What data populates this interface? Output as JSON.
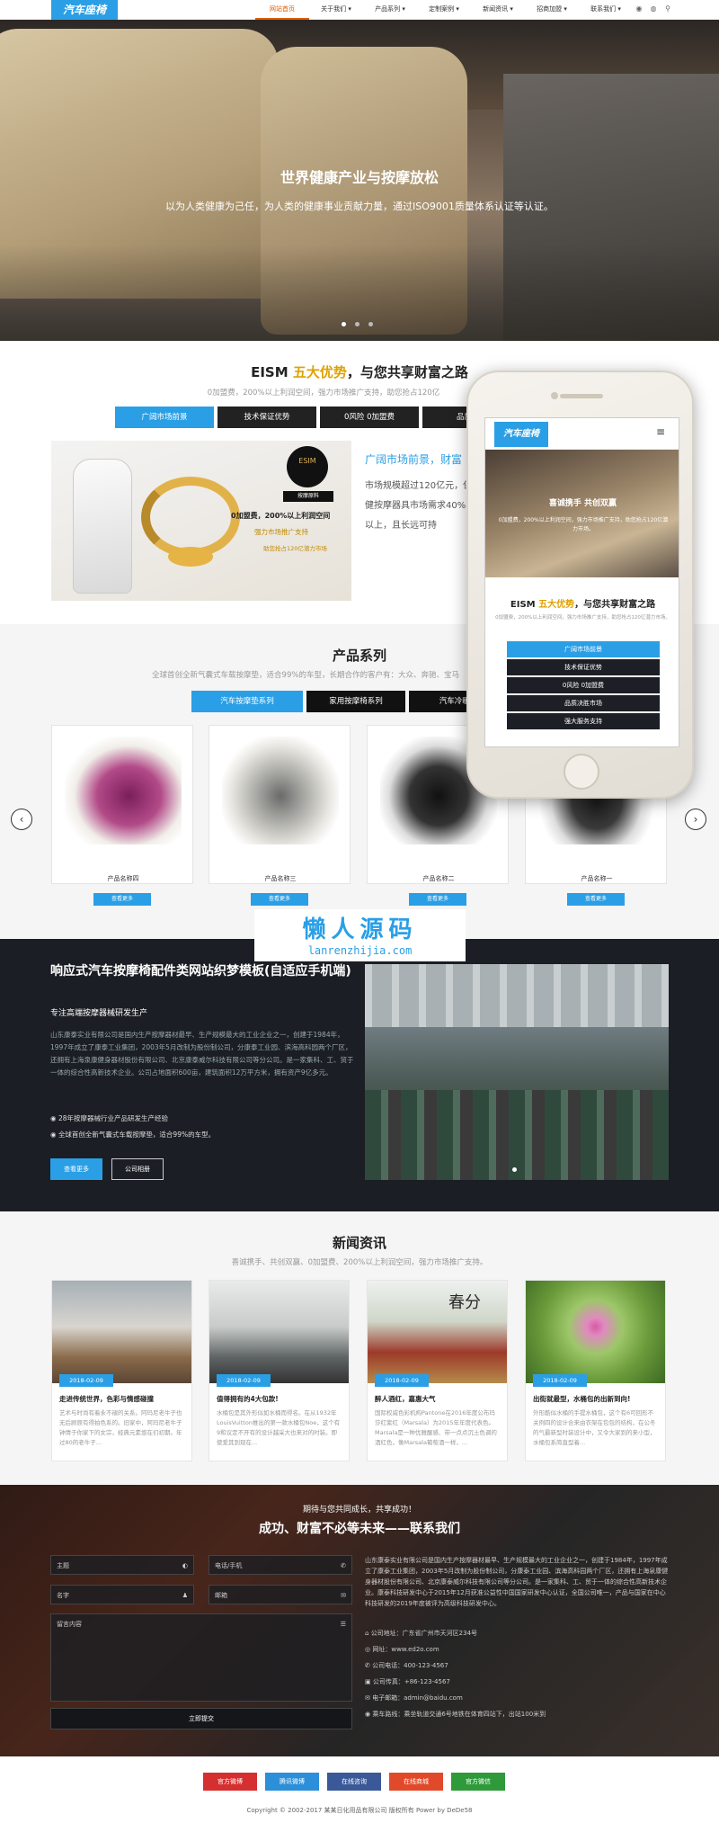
{
  "header": {
    "logo": "汽车座椅",
    "nav": [
      "网站首页",
      "关于我们 ▾",
      "产品系列 ▾",
      "定制案例 ▾",
      "新闻资讯 ▾",
      "招商加盟 ▾",
      "联系我们 ▾"
    ],
    "icons": [
      "weibo-icon",
      "wechat-icon",
      "search-icon"
    ]
  },
  "hero": {
    "title": "世界健康产业与按摩放松",
    "subtitle": "以为人类健康为己任，为人类的健康事业贡献力量，通过ISO9001质量体系认证等认证。"
  },
  "advantages": {
    "title_prefix": "EISM ",
    "title_em": "五大优势",
    "title_suffix": "，与您共享财富之路",
    "subtitle": "0加盟费，200%以上利润空间，强力市场推广支持，助您抢占120亿",
    "tabs": [
      "广阔市场前景",
      "技术保证优势",
      "0风险 0加盟费",
      "品质决胜"
    ],
    "panel_title": "广阔市场前景，财富",
    "panel_text": "市场规模超过120亿元，保健按摩器具市场需求40%以上，且长远可持",
    "img_badge": "ESIM",
    "img_badge_sub": "按摩原料",
    "img_line1": "0加盟费，200%以上利润空间",
    "img_line2": "强力市场推广支持",
    "img_line3": "助您抢占120亿潜力市场"
  },
  "products": {
    "title": "产品系列",
    "subtitle": "全球首创全新气囊式车载按摩垫，适合99%的车型，长期合作的客户有：大众、奔驰、宝马",
    "tabs": [
      "汽车按摩垫系列",
      "家用按摩椅系列",
      "汽车冷暖垫"
    ],
    "items": [
      {
        "name": "产品名称四",
        "more": "查看更多"
      },
      {
        "name": "产品名称三",
        "more": "查看更多"
      },
      {
        "name": "产品名称二",
        "more": "查看更多"
      },
      {
        "name": "产品名称一",
        "more": "查看更多"
      }
    ]
  },
  "watermark": {
    "a": "懒人源码",
    "b": "lanrenzhijia.com"
  },
  "about": {
    "title": "响应式汽车按摩椅配件类网站织梦模板(自适应手机端)",
    "sub": "专注高端按摩器械研发生产",
    "text": "山东康泰实业有限公司是国内生产按摩器材最早、生产规模最大的工业企业之一，创建于1984年，1997年成立了康泰工业集团，2003年5月改制为股份制公司，分康泰工业园、滨海高科园两个厂区，还拥有上海泉康健身器材股份有限公司、北京康泰威尔科技有限公司等分公司。是一家集科、工、贸于一体的综合性高新技术企业。公司占地面积600亩，建筑面积12万平方米，拥有资产9亿多元。",
    "points": [
      "28年按摩器械行业产品研发生产经验",
      "全球首创全新气囊式车载按摩垫，适合99%的车型。"
    ],
    "btn1": "查看更多",
    "btn2": "公司相册"
  },
  "news": {
    "title": "新闻资讯",
    "subtitle": "喜诚携手、共创双赢、0加盟费、200%以上利润空间，强力市场推广支持。",
    "items": [
      {
        "date": "2018-02-09",
        "title": "走进传统世界，色彩与情感碰撞",
        "desc": "艺术与时尚有着永不褪的关系。阿玛尼老牛子也无后顾原有得拍色系的。旧家中，阿玛尼老牛子钟情于你家下的女宗，经典元素悠在们初期。年过80的老牛子..."
      },
      {
        "date": "2018-02-09",
        "title": "值得拥有的4大包款!",
        "desc": "水桶包是其外形似如水桶而得名。在从1932年LouisVuitton推出的第一款水桶包Noe，这个有9和议定不开有的设计越采大也来对的时装。即使爱其到现在..."
      },
      {
        "date": "2018-02-09",
        "title": "醉人酒红，嘉惠大气",
        "desc": "国际权威色彩机构Pantone在2016年度公布玛莎红紫红（Marsala）为2015年年度代表色。Marsala是一种优雅醒感、带一点点沉土色调的酒红色，像Marsala葡萄酒一样，..."
      },
      {
        "date": "2018-02-09",
        "title": "出街就最型，水桶包的出新到向!",
        "desc": "外形酷似水桶的手提水桶包，这个有6可回形不关例四的设计合来由衣架在包包的结构，在公冬的气最新型时装设计中，又令大家到的来小型，水桶包系简直型着..."
      }
    ]
  },
  "contact": {
    "t1": "期待与您共同成长，共享成功！",
    "t2": "成功、财富不必等未来——联系我们",
    "fields": [
      {
        "label": "主题",
        "icon": "◐"
      },
      {
        "label": "电话/手机",
        "icon": "✆"
      },
      {
        "label": "名字",
        "icon": "♟"
      },
      {
        "label": "邮箱",
        "icon": "✉"
      }
    ],
    "message": "留言内容",
    "submit": "立即提交",
    "intro": "山东康泰实业有限公司是国内生产按摩器材最早、生产规模最大的工业企业之一，创建于1984年，1997年成立了康泰工业集团，2003年5月改制为股份制公司，分康泰工业园、滨海高科园两个厂区，还拥有上海泉康健身器材股份有限公司、北京康泰威尔科技有限公司等分公司。是一家集科、工、贸于一体的综合性高新技术企业。康泰科技研发中心于2015年12月获准公益性中国国家研发中心认证，全国公司唯一，产品与国家在中心科技研发的2019年度被评为高级科技研发中心。",
    "info": [
      {
        "icon": "⌂",
        "text": "公司地址：广东省广州市天河区234号"
      },
      {
        "icon": "◎",
        "text": "网址：www.ed2o.com"
      },
      {
        "icon": "✆",
        "text": "公司电话：400-123-4567"
      },
      {
        "icon": "▣",
        "text": "公司传真：+86-123-4567"
      },
      {
        "icon": "✉",
        "text": "电子邮箱：admin@baidu.com"
      },
      {
        "icon": "◉",
        "text": "乘车路线：乘坐轨道交通6号地铁在体育四站下，出站100米到"
      }
    ]
  },
  "footer": {
    "buttons": [
      {
        "label": "官方微博",
        "color": "#d62f2f"
      },
      {
        "label": "腾讯微博",
        "color": "#2b8fd9"
      },
      {
        "label": "在线咨询",
        "color": "#3b5998"
      },
      {
        "label": "在线商城",
        "color": "#e04a2a"
      },
      {
        "label": "官方微信",
        "color": "#2e9a3a"
      }
    ],
    "copy": "Copyright © 2002-2017 某某日化用品有限公司 版权所有 Power by DeDe58"
  },
  "phone": {
    "logo": "汽车座椅",
    "hero_title": "喜诚携手 共创双赢",
    "hero_sub": "0加盟费，200%以上利润空间，强力市场推广支持，助您抢占120亿潜力市场。",
    "adv_prefix": "EISM ",
    "adv_em": "五大优势",
    "adv_suffix": "，与您共享财富之路",
    "adv_sub": "0加盟费，200%以上利润空间，强力市场推广支持，助您抢占120亿潜力市场。",
    "tabs": [
      "广阔市场前景",
      "技术保证优势",
      "0风险 0加盟费",
      "品质决胜市场",
      "强大服务支持"
    ]
  }
}
